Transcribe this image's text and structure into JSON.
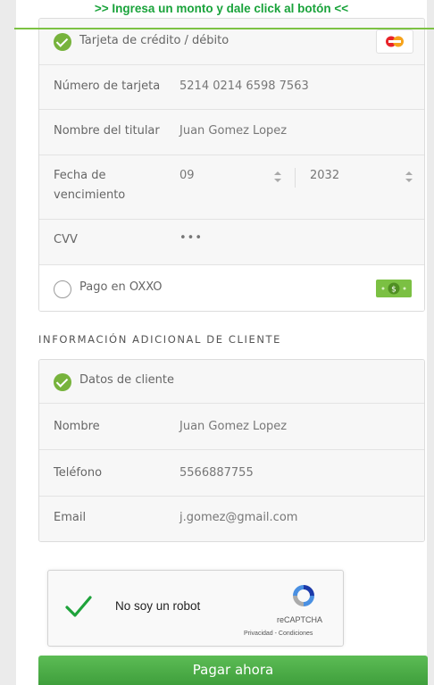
{
  "banner": {
    "text": ">> Ingresa un monto y dale click al botón <<"
  },
  "payment": {
    "card_option": {
      "label": "Tarjeta de crédito / débito",
      "icon": "card-brand-icon"
    },
    "card_number": {
      "label": "Número de tarjeta",
      "value": "5214 0214 6598 7563"
    },
    "holder": {
      "label": "Nombre del titular",
      "value": "Juan Gomez Lopez"
    },
    "expiry": {
      "label_line1": "Fecha de",
      "label_line2": "vencimiento",
      "month": "09",
      "year": "2032"
    },
    "cvv": {
      "label": "CVV",
      "value": "•••"
    },
    "oxxo_option": {
      "label": "Pago en OXXO",
      "icon": "cash-icon"
    }
  },
  "client": {
    "section_title": "INFORMACIÓN ADICIONAL DE CLIENTE",
    "header": "Datos de cliente",
    "name": {
      "label": "Nombre",
      "value": "Juan Gomez Lopez"
    },
    "phone": {
      "label": "Teléfono",
      "value": "5566887755"
    },
    "email": {
      "label": "Email",
      "value": "j.gomez@gmail.com"
    }
  },
  "recaptcha": {
    "label": "No soy un robot",
    "brand": "reCAPTCHA",
    "links": "Privacidad - Condiciones"
  },
  "pay_button": {
    "label": "Pagar ahora"
  },
  "colors": {
    "accent_green": "#77b33c",
    "banner_green": "#1aa33b",
    "button_green": "#4cae47"
  }
}
